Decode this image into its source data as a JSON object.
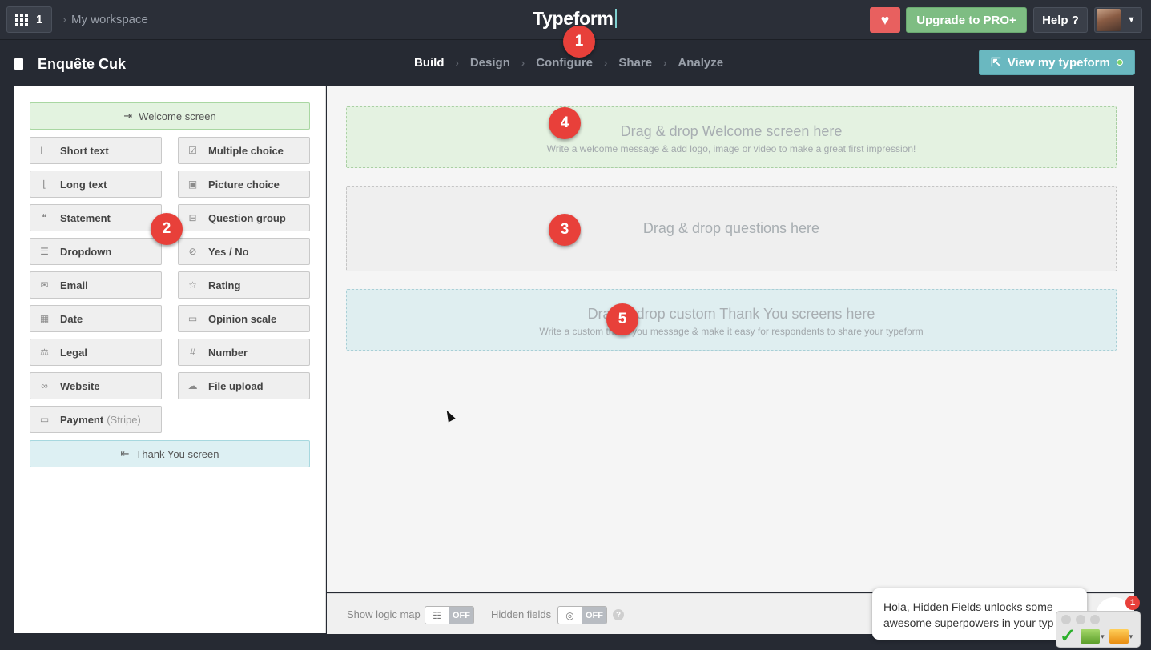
{
  "topbar": {
    "apps_count": "1",
    "workspace": "My workspace",
    "logo": "Typeform",
    "upgrade_label": "Upgrade to PRO+",
    "help_label": "Help ?"
  },
  "subbar": {
    "form_title": "Enquête Cuk",
    "steps": [
      "Build",
      "Design",
      "Configure",
      "Share",
      "Analyze"
    ],
    "active_step": "Build",
    "view_label": "View my typeform"
  },
  "sidebar": {
    "welcome_label": "Welcome screen",
    "thanks_label": "Thank You screen",
    "left_items": [
      {
        "label": "Short text",
        "icon": "short-text-icon"
      },
      {
        "label": "Long text",
        "icon": "long-text-icon"
      },
      {
        "label": "Statement",
        "icon": "statement-icon"
      },
      {
        "label": "Dropdown",
        "icon": "dropdown-icon"
      },
      {
        "label": "Email",
        "icon": "email-icon"
      },
      {
        "label": "Date",
        "icon": "calendar-icon"
      },
      {
        "label": "Legal",
        "icon": "scales-icon"
      },
      {
        "label": "Website",
        "icon": "link-icon"
      },
      {
        "label": "Payment",
        "suffix": "(Stripe)",
        "icon": "card-icon"
      }
    ],
    "right_items": [
      {
        "label": "Multiple choice",
        "icon": "checkbox-icon"
      },
      {
        "label": "Picture choice",
        "icon": "picture-icon"
      },
      {
        "label": "Question group",
        "icon": "group-icon"
      },
      {
        "label": "Yes / No",
        "icon": "yes-no-icon"
      },
      {
        "label": "Rating",
        "icon": "star-icon"
      },
      {
        "label": "Opinion scale",
        "icon": "scale-icon"
      },
      {
        "label": "Number",
        "icon": "hash-icon"
      },
      {
        "label": "File upload",
        "icon": "cloud-upload-icon"
      }
    ]
  },
  "builder": {
    "welcome_title": "Drag & drop Welcome screen here",
    "welcome_sub": "Write a welcome message & add logo, image or video to make a great first impression!",
    "questions_title": "Drag & drop questions here",
    "thanks_title": "Drag & drop custom Thank You screens here",
    "thanks_sub": "Write a custom thank you message & make it easy for respondents to share your typeform"
  },
  "bottombar": {
    "logic_label": "Show logic map",
    "logic_state": "OFF",
    "hidden_label": "Hidden fields",
    "hidden_state": "OFF"
  },
  "chat": {
    "line1": "Hola, Hidden Fields unlocks some",
    "line2": "awesome superpowers in your typ",
    "badge": "1"
  },
  "annotations": [
    "1",
    "2",
    "3",
    "4",
    "5"
  ],
  "colors": {
    "topbar_bg": "#2b2f38",
    "upgrade_green": "#7ebd83",
    "heart_red": "#e8605f",
    "view_teal": "#6ab8c0",
    "badge_red": "#e8403a"
  }
}
